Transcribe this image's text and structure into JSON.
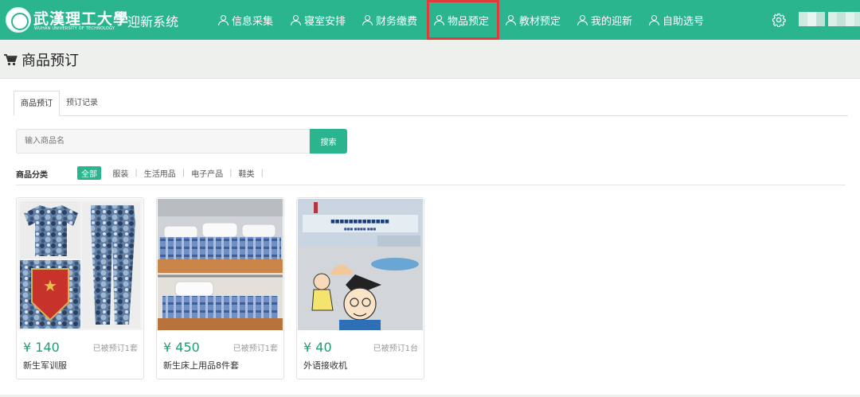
{
  "brand": {
    "name_cn": "武漢理工大學",
    "name_en": "WUHAN UNIVERSITY OF TECHNOLOGY",
    "separator": "·",
    "system_title": "迎新系统"
  },
  "nav": {
    "items": [
      {
        "label": "信息采集",
        "icon": "user-icon"
      },
      {
        "label": "寝室安排",
        "icon": "user-icon"
      },
      {
        "label": "财务缴费",
        "icon": "user-icon"
      },
      {
        "label": "物品预定",
        "icon": "user-icon",
        "active": true
      },
      {
        "label": "教材预定",
        "icon": "user-icon"
      },
      {
        "label": "我的迎新",
        "icon": "user-icon"
      },
      {
        "label": "自助选号",
        "icon": "user-icon"
      }
    ],
    "settings_icon": "gear-icon"
  },
  "page": {
    "title": "商品预订",
    "icon": "cart-icon"
  },
  "tabs": [
    "商品预订",
    "预订记录"
  ],
  "search": {
    "placeholder": "输入商品名",
    "button": "搜索"
  },
  "categories": {
    "label": "商品分类",
    "items": [
      "全部",
      "服装",
      "生活用品",
      "电子产品",
      "鞋类"
    ],
    "selected": "全部"
  },
  "products": [
    {
      "price": "¥ 140",
      "reserved": "已被预订1套",
      "name": "新生军训服"
    },
    {
      "price": "¥ 450",
      "reserved": "已被预订1套",
      "name": "新生床上用品8件套"
    },
    {
      "price": "¥ 40",
      "reserved": "已被预订1台",
      "name": "外语接收机"
    }
  ],
  "colors": {
    "accent": "#2bb58f",
    "price": "#1f9e6f",
    "active_outline": "#e23a3a"
  }
}
